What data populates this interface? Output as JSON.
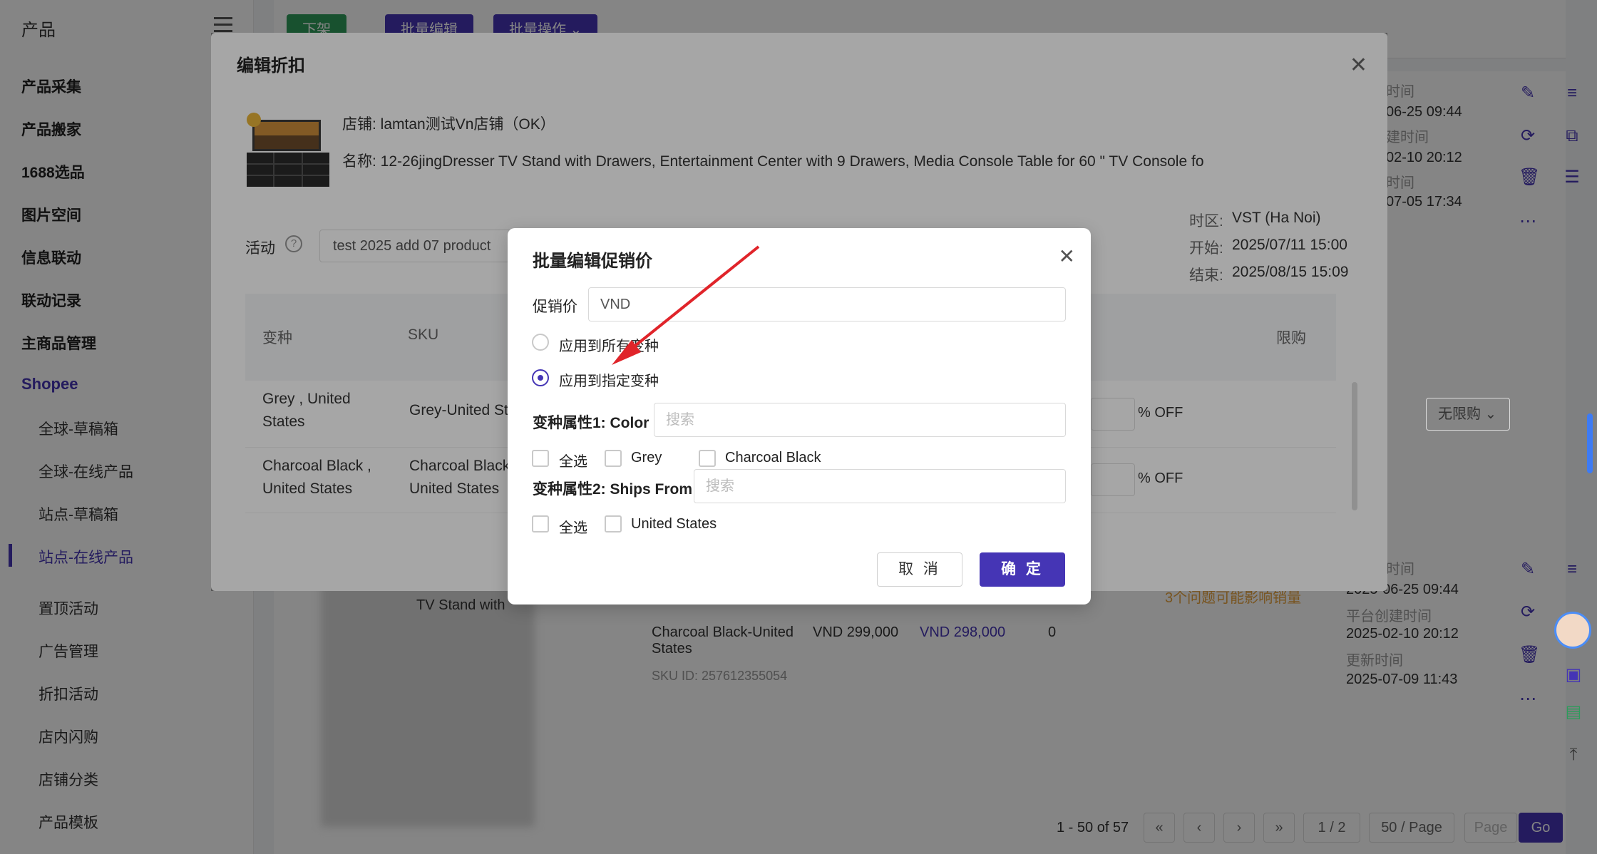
{
  "sidebar": {
    "header": "产品",
    "items": [
      "产品采集",
      "产品搬家",
      "1688选品",
      "图片空间",
      "信息联动",
      "联动记录",
      "主商品管理"
    ],
    "group": "Shopee",
    "sub_items": [
      "全球-草稿箱",
      "全球-在线产品",
      "站点-草稿箱",
      "站点-在线产品"
    ],
    "active_sub": "站点-在线产品",
    "more_items": [
      "置顶活动",
      "广告管理",
      "折扣活动",
      "店内闪购",
      "店铺分类",
      "产品模板"
    ]
  },
  "toolbar": {
    "btn_off": "下架",
    "btn_batch_edit": "批量编辑",
    "btn_batch_ops": "批量操作 ⌄"
  },
  "background": {
    "time_labels": [
      "时间",
      "建时间",
      "时间"
    ],
    "time_values": [
      "06-25 09:44",
      "02-10 20:12",
      "07-05 17:34"
    ],
    "row2": {
      "title_lines": [
        "TV Stand with"
      ],
      "variant": "Charcoal Black-United States",
      "sku_id": "SKU ID: 257612355054",
      "price": "VND 299,000",
      "promo_price": "VND 298,000",
      "stock": "0",
      "warning": "3个问题可能影响销量",
      "times": [
        "2025-06-25 09:44",
        "平台创建时间",
        "2025-02-10 20:12",
        "更新时间",
        "2025-07-09 11:43"
      ],
      "time_label_top": "时间"
    },
    "pager": {
      "range": "1 - 50 of 57",
      "page": "1 / 2",
      "page_size": "50 / Page",
      "page_placeholder": "Page",
      "go": "Go"
    }
  },
  "edit_dialog": {
    "title": "编辑折扣",
    "store": "店铺: lamtan测试Vn店铺（OK）",
    "name": "名称: 12-26jingDresser TV Stand with Drawers, Entertainment Center with 9 Drawers, Media Console Table for 60 \" TV Console fo",
    "activity_label": "活动",
    "activity_value": "test 2025 add 07 product",
    "tz_label": "时区:",
    "tz_value": "VST (Ha Noi)",
    "start_label": "开始:",
    "start_value": "2025/07/11 15:00",
    "end_label": "结束:",
    "end_value": "2025/08/15 15:09",
    "columns": [
      "变种",
      "SKU",
      "限购"
    ],
    "rows": [
      {
        "variant_l1": "Grey , United",
        "variant_l2": "States",
        "sku": "Grey-United Sta",
        "off": "% OFF",
        "limit": "无限购"
      },
      {
        "variant_l1": "Charcoal Black ,",
        "variant_l2": "United States",
        "sku_l1": "Charcoal Black",
        "sku_l2": "United States",
        "off": "% OFF"
      }
    ]
  },
  "batch_dialog": {
    "title": "批量编辑促销价",
    "price_label": "促销价",
    "price_value": "VND",
    "radio_all": "应用到所有变种",
    "radio_specific": "应用到指定变种",
    "attr1_label": "变种属性1: Color",
    "attr1_placeholder": "搜索",
    "attr1_options": [
      "全选",
      "Grey",
      "Charcoal Black"
    ],
    "attr2_label": "变种属性2: Ships From",
    "attr2_placeholder": "搜索",
    "attr2_options": [
      "全选",
      "United States"
    ],
    "cancel": "取 消",
    "confirm": "确 定"
  },
  "colors": {
    "accent": "#4535b5",
    "annotation_arrow": "#e0242a"
  }
}
